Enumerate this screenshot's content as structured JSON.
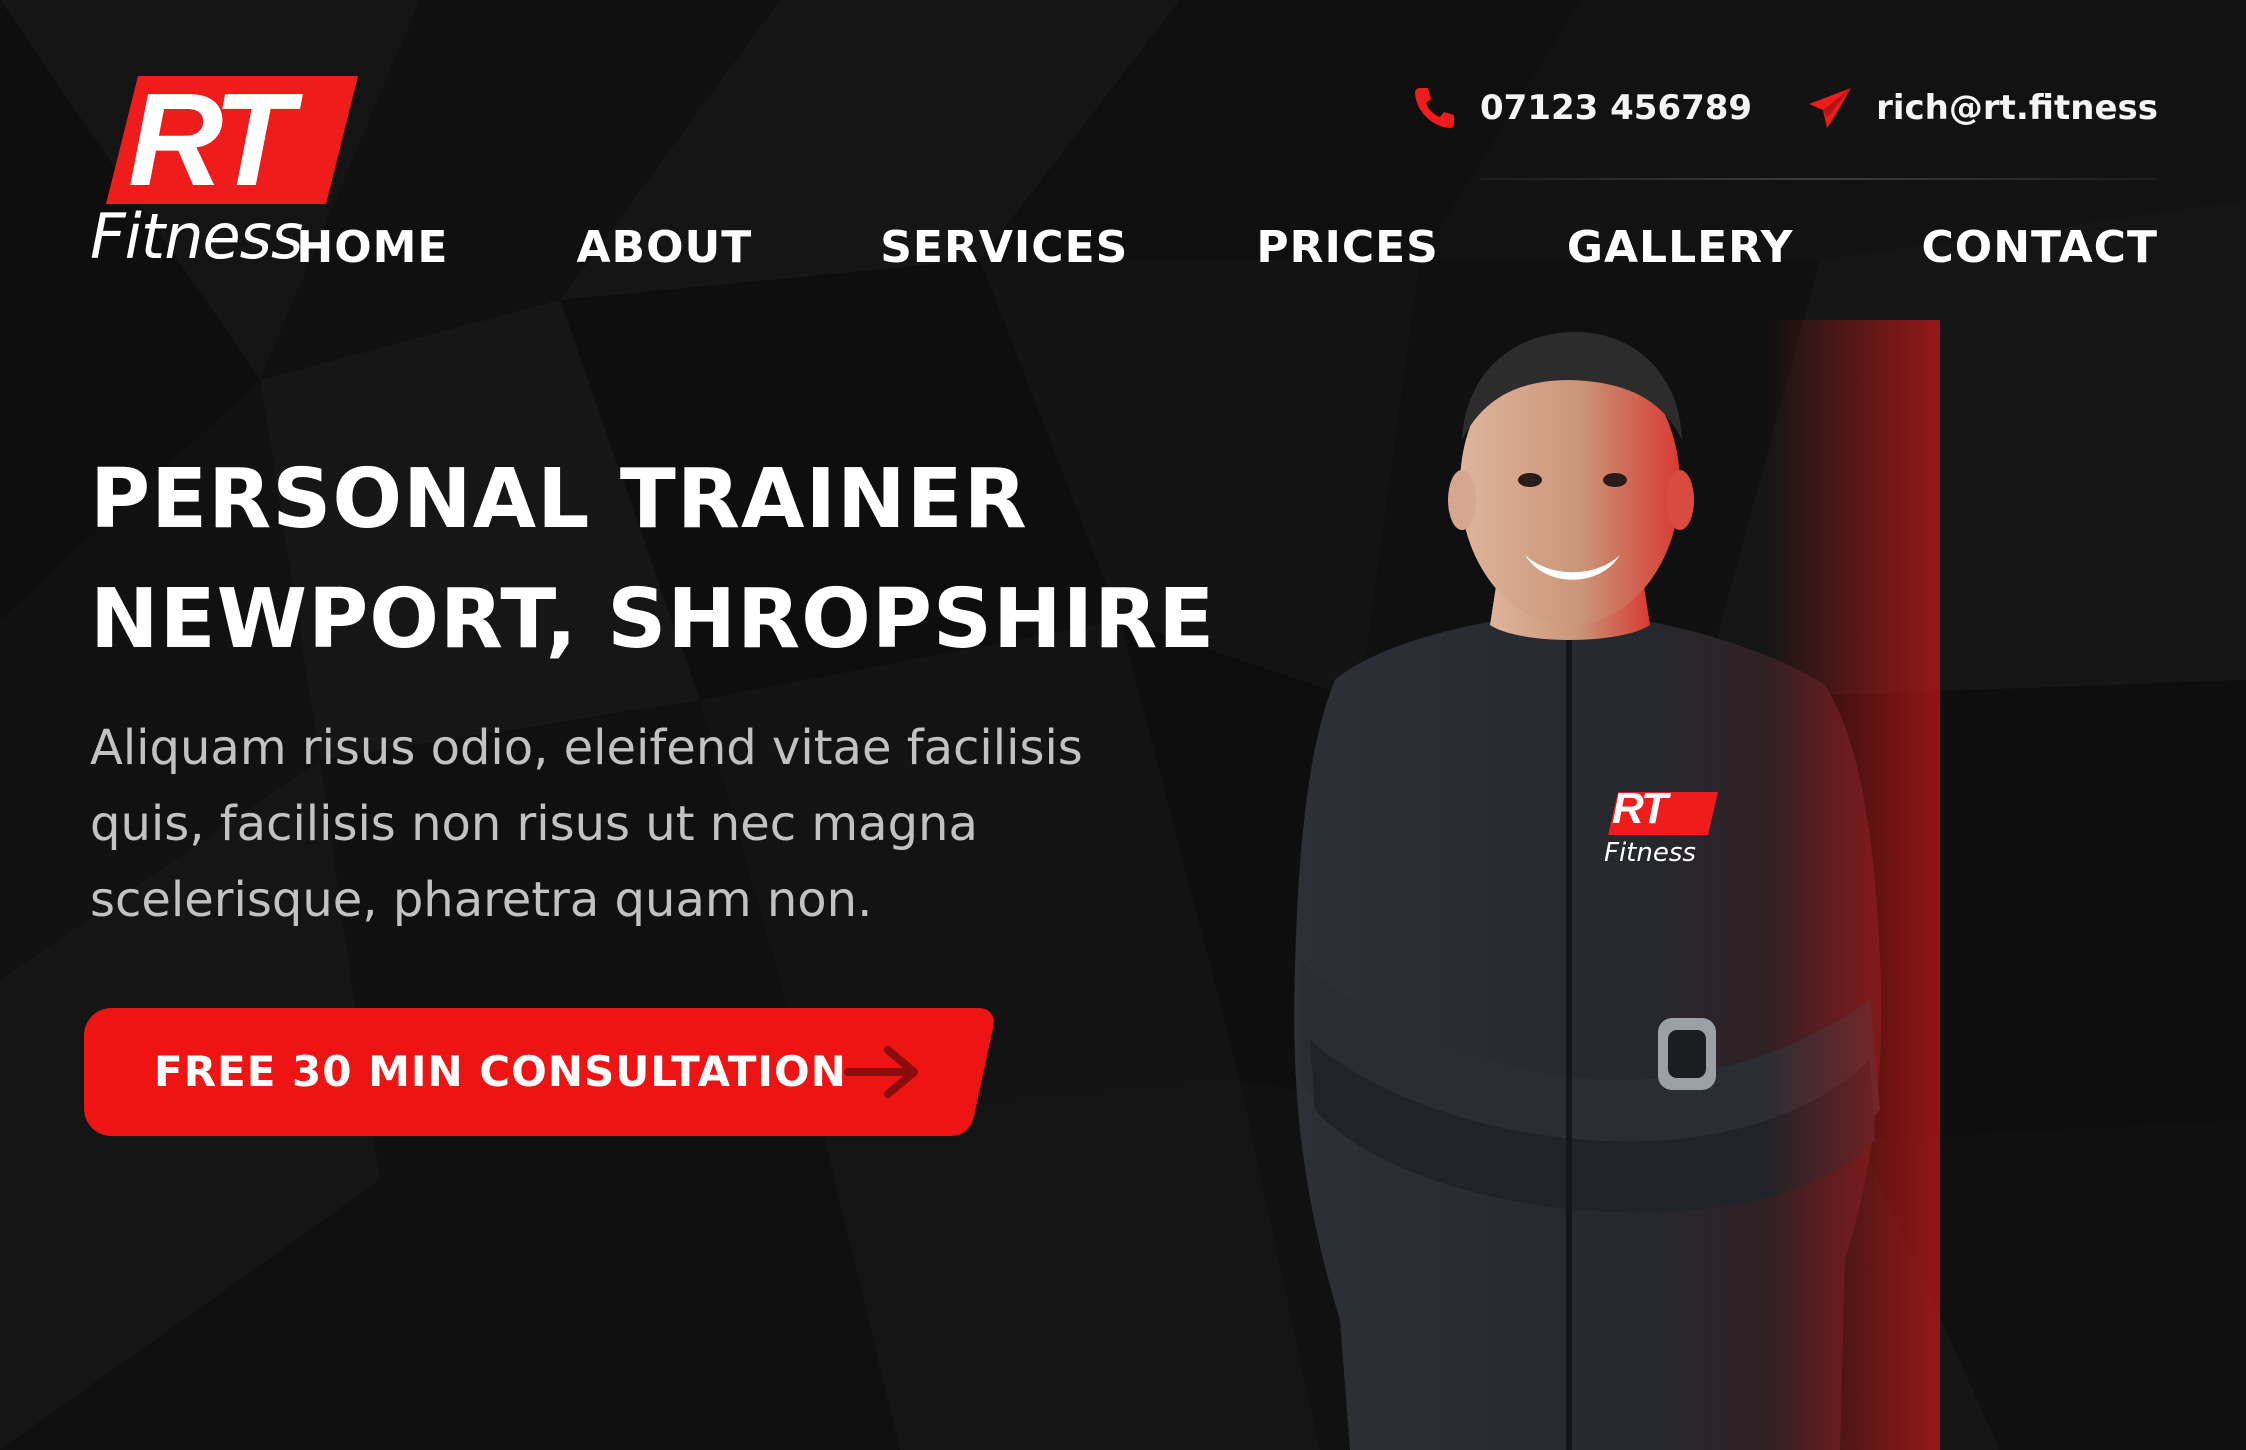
{
  "brand": {
    "logo_top": "RT",
    "logo_bottom": "Fitness",
    "accent_color": "#ef1c1c"
  },
  "contact": {
    "phone": "07123 456789",
    "phone_icon": "phone-icon",
    "email": "rich@rt.fitness",
    "email_icon": "paper-plane-icon"
  },
  "nav": {
    "items": [
      {
        "label": "HOME"
      },
      {
        "label": "ABOUT"
      },
      {
        "label": "SERVICES"
      },
      {
        "label": "PRICES"
      },
      {
        "label": "GALLERY"
      },
      {
        "label": "CONTACT"
      }
    ]
  },
  "hero": {
    "title_line1": "PERSONAL TRAINER",
    "title_line2": "NEWPORT, SHROPSHIRE",
    "description": "Aliquam risus odio, eleifend vitae facilisis quis, facilisis non risus ut nec magna scelerisque, pharetra quam non.",
    "cta_label": "FREE 30 MIN CONSULTATION",
    "cta_icon": "arrow-right-icon"
  },
  "shirt_logo": {
    "top": "RT",
    "bottom": "Fitness"
  }
}
